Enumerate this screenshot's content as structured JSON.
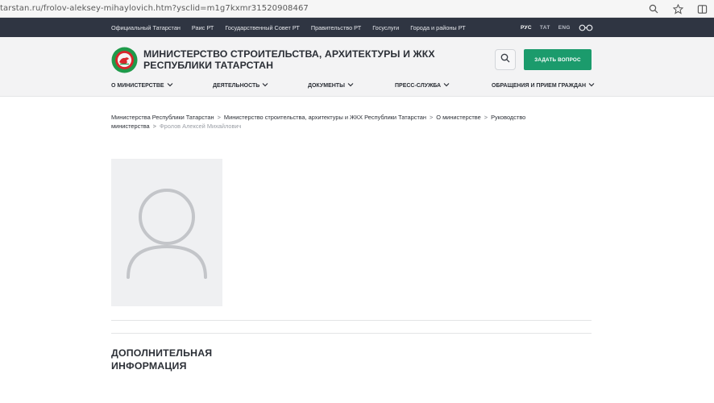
{
  "browser": {
    "url": "tarstan.ru/frolov-aleksey-mihaylovich.htm?ysclid=m1g7kxmr31520908467"
  },
  "top_links": [
    "Официальный Татарстан",
    "Раис РТ",
    "Государственный Совет РТ",
    "Правительство РТ",
    "Госуслуги",
    "Города и районы РТ"
  ],
  "languages": [
    "РУС",
    "ТАТ",
    "ENG"
  ],
  "header": {
    "ministry_name": "МИНИСТЕРСТВО СТРОИТЕЛЬСТВА, АРХИТЕКТУРЫ И ЖКХ РЕСПУБЛИКИ ТАТАРСТАН",
    "ask_button": "ЗАДАТЬ ВОПРОС"
  },
  "nav": [
    "О МИНИСТЕРСТВЕ",
    "ДЕЯТЕЛЬНОСТЬ",
    "ДОКУМЕНТЫ",
    "ПРЕСС-СЛУЖБА",
    "ОБРАЩЕНИЯ И ПРИЕМ ГРАЖДАН"
  ],
  "breadcrumb": [
    "Министерства Республики Татарстан",
    "Министерство строительства, архитектуры и ЖКХ Республики Татарстан",
    "О министерстве",
    "Руководство министерства",
    "Фролов Алексей Михайлович"
  ],
  "section": {
    "title": "ДОПОЛНИТЕЛЬНАЯ ИНФОРМАЦИЯ"
  },
  "colors": {
    "top_strip": "#2f3542",
    "accent_green": "#1b9b6c",
    "emblem_green": "#1f9a4a",
    "emblem_red": "#d8262c"
  }
}
